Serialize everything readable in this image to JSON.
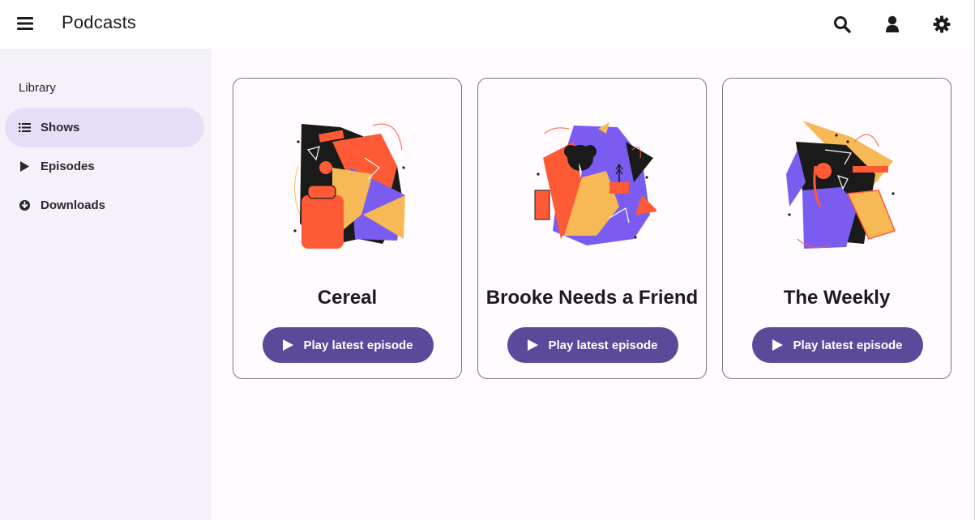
{
  "app": {
    "title": "Podcasts"
  },
  "topbar": {
    "icons": [
      "menu-icon",
      "search-icon",
      "account-icon",
      "settings-icon"
    ]
  },
  "sidebar": {
    "heading": "Library",
    "items": [
      {
        "label": "Shows",
        "icon": "list-icon",
        "active": true
      },
      {
        "label": "Episodes",
        "icon": "play-icon",
        "active": false
      },
      {
        "label": "Downloads",
        "icon": "download-icon",
        "active": false
      }
    ]
  },
  "shows": [
    {
      "title": "Cereal",
      "button_label": "Play latest episode"
    },
    {
      "title": "Brooke Needs a Friend",
      "button_label": "Play latest episode"
    },
    {
      "title": "The Weekly",
      "button_label": "Play latest episode"
    }
  ],
  "colors": {
    "accent": "#5b4a99",
    "active_nav": "#e5def7",
    "sidebar_bg": "#f4f1f8",
    "art_orange": "#ff5a36",
    "art_purple": "#7a5cf0",
    "art_yellow": "#f7b955"
  }
}
